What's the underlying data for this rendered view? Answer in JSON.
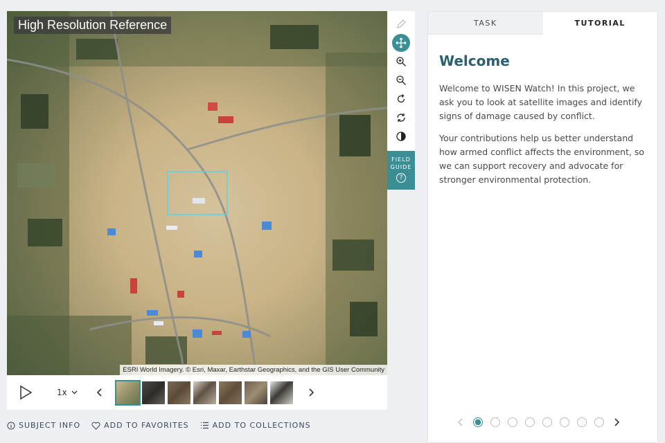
{
  "viewer": {
    "reference_label": "High Resolution Reference",
    "attribution": "ESRI World Imagery. © Esri, Maxar, Earthstar Geographics, and the GIS User Community"
  },
  "toolbar": {
    "tools": [
      "pencil-icon",
      "move-icon",
      "zoom-in-icon",
      "zoom-out-icon",
      "rotate-icon",
      "reset-icon",
      "contrast-icon"
    ],
    "active_tool": "move-icon",
    "field_guide_line1": "FIELD",
    "field_guide_line2": "GUIDE",
    "field_guide_icon": "?"
  },
  "controls": {
    "speed": "1x",
    "thumbnail_count": 7,
    "active_thumbnail": 1
  },
  "footer": {
    "subject_info": "SUBJECT INFO",
    "add_to_favorites": "ADD TO FAVORITES",
    "add_to_collections": "ADD TO COLLECTIONS"
  },
  "panel": {
    "tabs": {
      "task": "TASK",
      "tutorial": "TUTORIAL"
    },
    "active_tab": "TUTORIAL",
    "title": "Welcome",
    "paragraph1": "Welcome to WISEN Watch! In this project, we ask you to look at satellite images and identify signs of damage caused by conflict.",
    "paragraph2": "Your contributions help us better understand how armed conflict affects the environment, so we can support recovery and advocate for stronger environmental protection.",
    "step_count": 8,
    "active_step": 1
  },
  "colors": {
    "accent": "#3a8e94",
    "title": "#2d5f6e"
  }
}
